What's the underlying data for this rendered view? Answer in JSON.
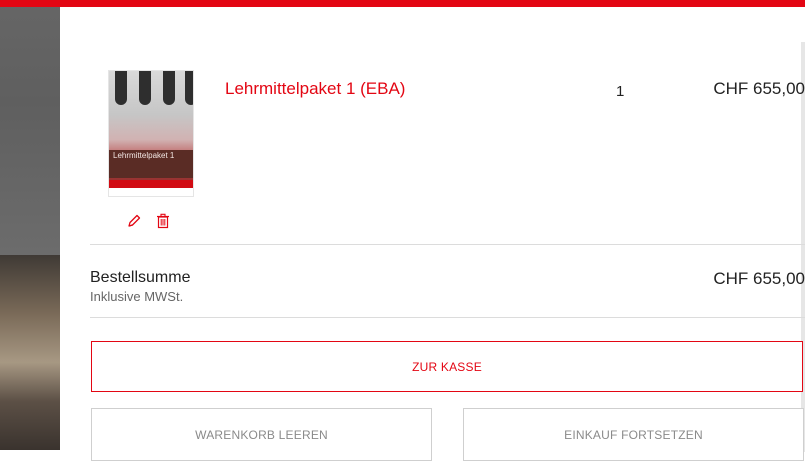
{
  "brand": {
    "accent_color": "#e30613"
  },
  "cart": {
    "items": [
      {
        "name": "Lehrmittelpaket 1 (EBA)",
        "cover_title": "Lehrmittelpaket 1",
        "quantity": "1",
        "price": "CHF 655,00",
        "icons": [
          "edit-icon",
          "trash-icon"
        ]
      }
    ],
    "summary": {
      "label": "Bestellsumme",
      "sub_label": "Inklusive MWSt.",
      "total": "CHF 655,00"
    },
    "actions": {
      "checkout": "ZUR KASSE",
      "clear": "WARENKORB LEEREN",
      "continue": "EINKAUF FORTSETZEN"
    }
  }
}
